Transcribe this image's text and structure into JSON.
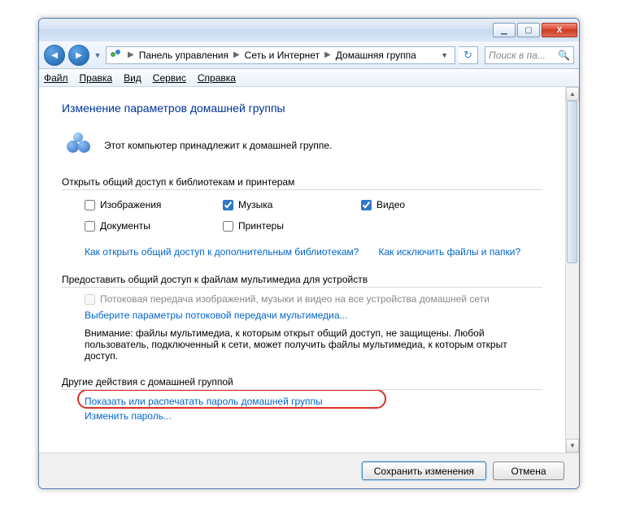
{
  "titlebar": {
    "minimize": "▁",
    "maximize": "▢",
    "close": "X"
  },
  "nav": {
    "crumb1": "Панель управления",
    "crumb2": "Сеть и Интернет",
    "crumb3": "Домашняя группа",
    "search_placeholder": "Поиск в па..."
  },
  "menu": {
    "file": "Файл",
    "edit": "Правка",
    "view": "Вид",
    "tools": "Сервис",
    "help": "Справка"
  },
  "page": {
    "title": "Изменение параметров домашней группы",
    "belongs": "Этот компьютер принадлежит к домашней группе.",
    "section_libs": "Открыть общий доступ к библиотекам и принтерам",
    "lib_images": "Изображения",
    "lib_music": "Музыка",
    "lib_video": "Видео",
    "lib_docs": "Документы",
    "lib_printers": "Принтеры",
    "link_more_libs": "Как открыть общий доступ к дополнительным библиотекам?",
    "link_exclude": "Как исключить файлы и папки?",
    "section_stream": "Предоставить общий доступ к файлам мультимедиа для устройств",
    "stream_chk": "Потоковая передача изображений, музыки и видео на все устройства домашней сети",
    "stream_link": "Выберите параметры потоковой передачи мультимедиа...",
    "warn": "Внимание: файлы мультимедиа, к которым открыт общий доступ, не защищены. Любой пользователь, подключенный к сети, может получить файлы мультимедиа, к которым открыт доступ.",
    "section_other": "Другие действия с домашней группой",
    "link_password": "Показать или распечатать пароль домашней группы",
    "link_change_pw": "Изменить пароль..."
  },
  "footer": {
    "save": "Сохранить изменения",
    "cancel": "Отмена"
  },
  "checked": {
    "images": false,
    "music": true,
    "video": true,
    "docs": false,
    "printers": false,
    "stream": false
  }
}
